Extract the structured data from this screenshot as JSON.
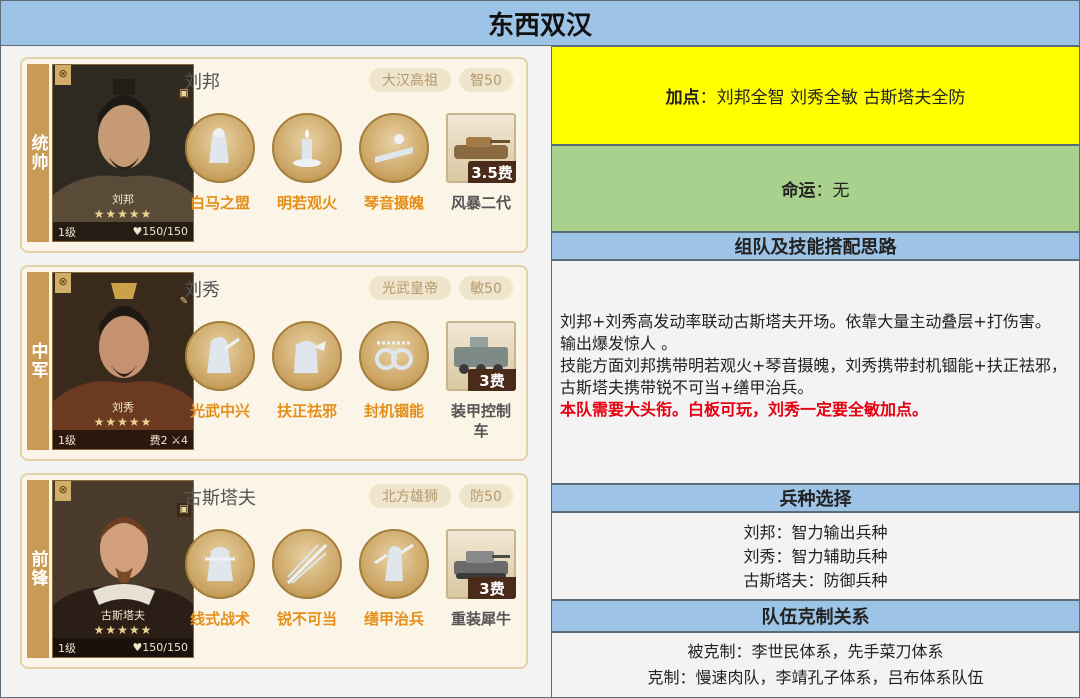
{
  "title": "东西双汉",
  "heroes": [
    {
      "role": "统帅",
      "name": "刘邦",
      "title_tag": "大汉高祖",
      "stat_tag": "智50",
      "portrait_name": "刘邦",
      "stars": "★★★★★",
      "level": "1级",
      "extra": "♥150/150",
      "skills": [
        "白马之盟",
        "明若观火",
        "琴音摄魄"
      ],
      "unit": "风暴二代",
      "unit_cost": "3.5费"
    },
    {
      "role": "中军",
      "name": "刘秀",
      "title_tag": "光武皇帝",
      "stat_tag": "敏50",
      "portrait_name": "刘秀",
      "stars": "★★★★★",
      "level": "1级",
      "extra": "费2 ⚔4",
      "skills": [
        "光武中兴",
        "扶正祛邪",
        "封机锢能"
      ],
      "unit": "装甲控制车",
      "unit_cost": "3费"
    },
    {
      "role": "前锋",
      "name": "古斯塔夫",
      "title_tag": "北方雄狮",
      "stat_tag": "防50",
      "portrait_name": "古斯塔夫",
      "stars": "★★★★★",
      "level": "1级",
      "extra": "♥150/150",
      "skills": [
        "线式战术",
        "锐不可当",
        "缮甲治兵"
      ],
      "unit": "重装犀牛",
      "unit_cost": "3费"
    }
  ],
  "points": {
    "label": "加点",
    "text": "：刘邦全智 刘秀全敏 古斯塔夫全防"
  },
  "fate": {
    "label": "命运",
    "text": "：无"
  },
  "strategy": {
    "header": "组队及技能搭配思路",
    "para1": "刘邦+刘秀高发动率联动古斯塔夫开场。依靠大量主动叠层+打伤害。 输出爆发惊人 。",
    "para2": "技能方面刘邦携带明若观火+琴音摄魄，刘秀携带封机锢能+扶正祛邪，古斯塔夫携带锐不可当+缮甲治兵。",
    "note": "本队需要大头衔。白板可玩，刘秀一定要全敏加点。"
  },
  "troops": {
    "header": "兵种选择",
    "lines": [
      "刘邦：智力输出兵种",
      "刘秀：智力辅助兵种",
      "古斯塔夫：防御兵种"
    ]
  },
  "counter": {
    "header": "队伍克制关系",
    "lines": [
      "被克制：李世民体系，先手菜刀体系",
      "克制：慢速肉队，李靖孔子体系，吕布体系队伍"
    ]
  }
}
